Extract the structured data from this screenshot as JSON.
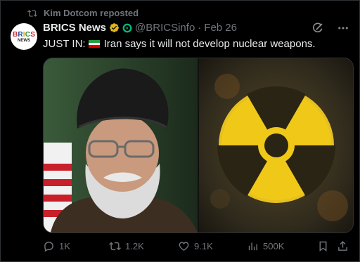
{
  "repost": {
    "icon": "repost-icon",
    "text": "Kim Dotcom reposted"
  },
  "author": {
    "name": "BRICS News",
    "handle": "@BRICSinfo",
    "separator": "·",
    "date": "Feb 26",
    "avatar_line1": "BRICS",
    "avatar_line2": "NEWS",
    "verified_color": "#e2b719",
    "affiliate_color": "#00ba7c"
  },
  "tweet": {
    "prefix": "JUST IN:",
    "flag": "Iran flag",
    "text": "Iran says it will not develop nuclear weapons."
  },
  "media": {
    "left": "portrait photo",
    "right": "radiation hazard symbol"
  },
  "actions": {
    "replies": "1K",
    "reposts": "1.2K",
    "likes": "9.1K",
    "views": "500K"
  },
  "colors": {
    "background": "#000000",
    "text": "#e7e9ea",
    "muted": "#71767b",
    "border": "#2f3336"
  }
}
